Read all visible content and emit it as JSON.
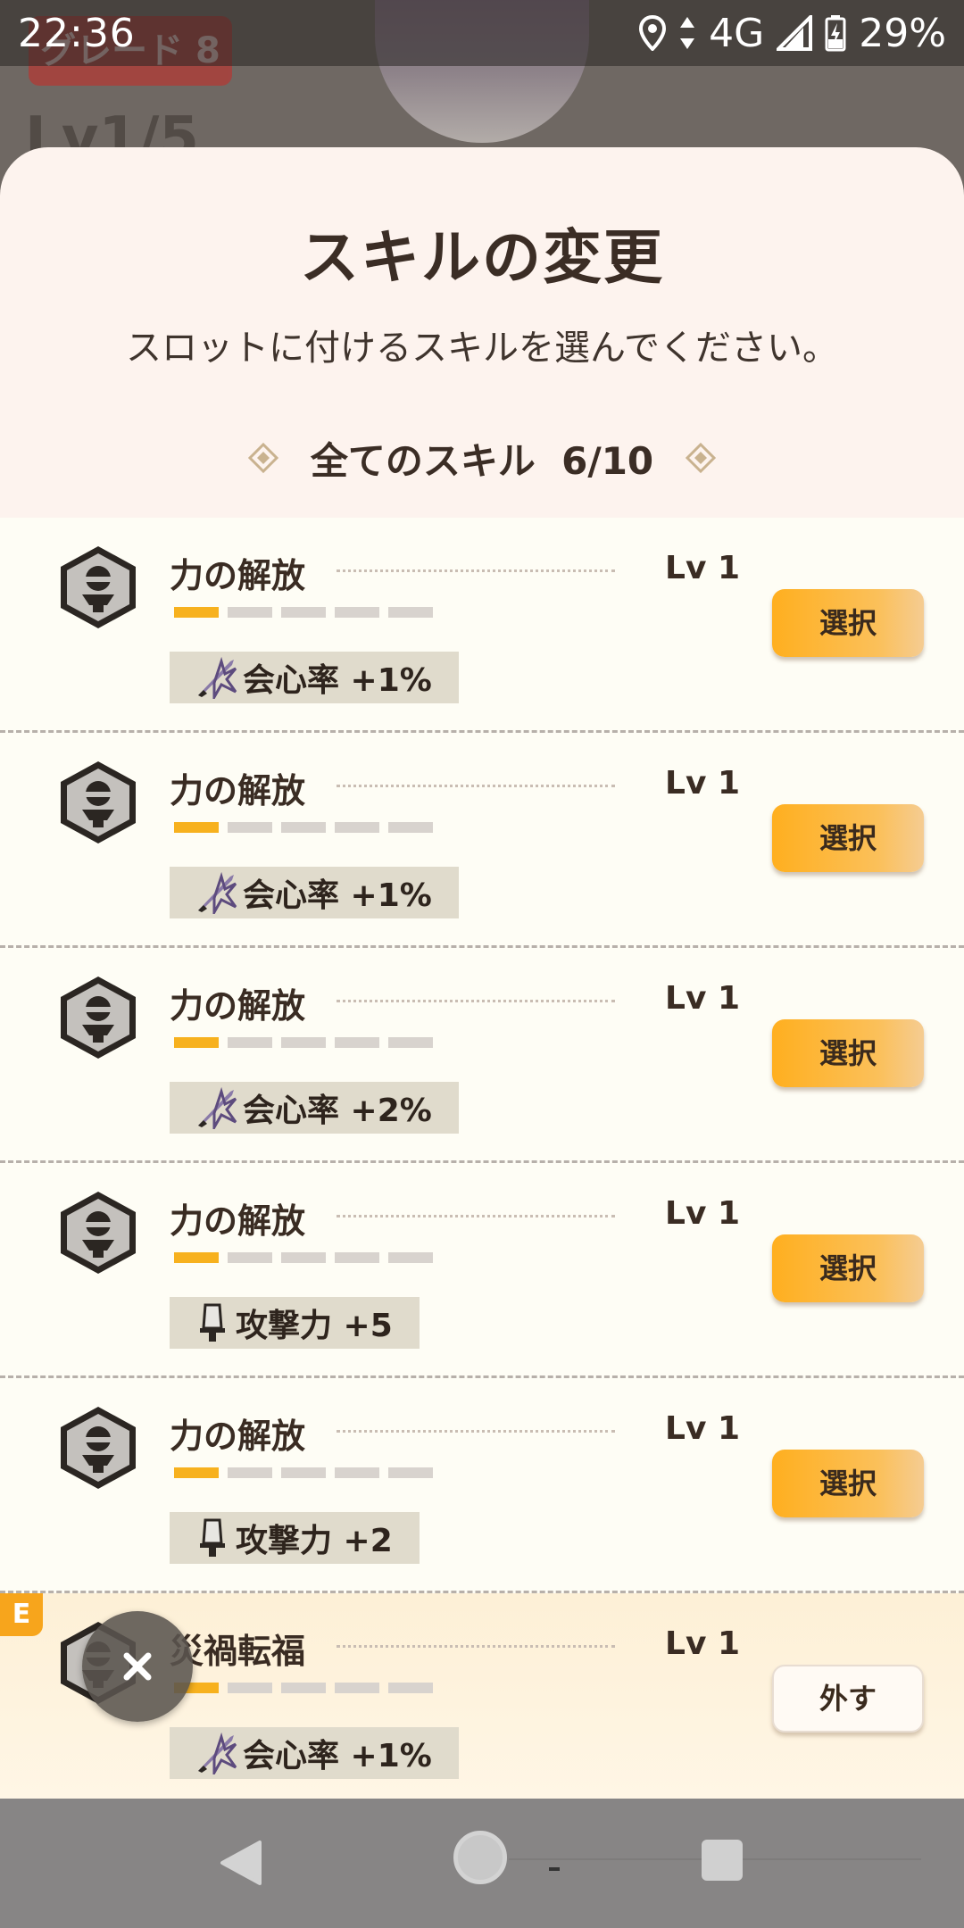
{
  "status_bar": {
    "time": "22:36",
    "network": "4G",
    "battery": "29%"
  },
  "background": {
    "grade_label": "グレード 8",
    "level_label": "Lv1/5"
  },
  "modal": {
    "title": "スキルの変更",
    "subtitle": "スロットに付けるスキルを選んでください。",
    "section_label": "全てのスキル",
    "section_count": "6/10"
  },
  "skills": [
    {
      "name": "力の解放",
      "level": "Lv 1",
      "pips_filled": 1,
      "pips_total": 5,
      "stat_icon": "critical-icon",
      "stat": "会心率 +1%",
      "action": "選択"
    },
    {
      "name": "力の解放",
      "level": "Lv 1",
      "pips_filled": 1,
      "pips_total": 5,
      "stat_icon": "critical-icon",
      "stat": "会心率 +1%",
      "action": "選択"
    },
    {
      "name": "力の解放",
      "level": "Lv 1",
      "pips_filled": 1,
      "pips_total": 5,
      "stat_icon": "critical-icon",
      "stat": "会心率 +2%",
      "action": "選択"
    },
    {
      "name": "力の解放",
      "level": "Lv 1",
      "pips_filled": 1,
      "pips_total": 5,
      "stat_icon": "attack-icon",
      "stat": "攻撃力 +5",
      "action": "選択"
    },
    {
      "name": "力の解放",
      "level": "Lv 1",
      "pips_filled": 1,
      "pips_total": 5,
      "stat_icon": "attack-icon",
      "stat": "攻撃力 +2",
      "action": "選択"
    },
    {
      "name": "災禍転福",
      "level": "Lv 1",
      "pips_filled": 1,
      "pips_total": 5,
      "stat_icon": "critical-icon",
      "stat": "会心率 +1%",
      "action": "外す",
      "equipped_badge": "E"
    }
  ],
  "colors": {
    "accent": "#f7b11e",
    "sheet_bg": "#fdf3ee",
    "row_bg": "#fefdf5"
  }
}
